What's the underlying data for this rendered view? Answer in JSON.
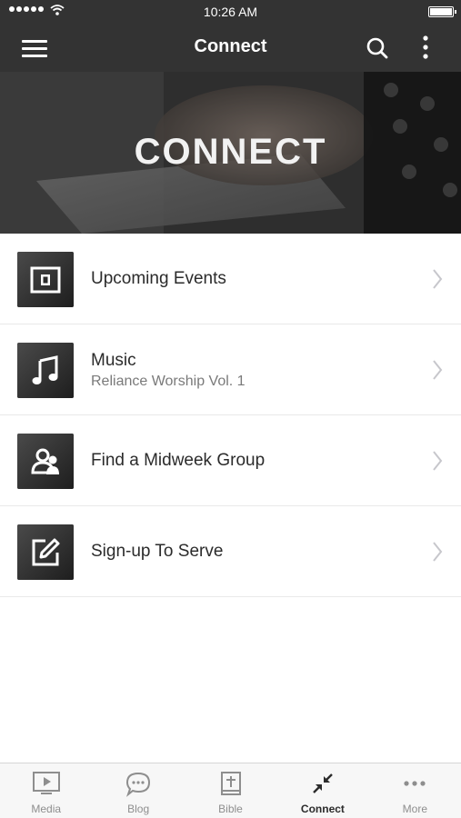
{
  "status_bar": {
    "time": "10:26 AM"
  },
  "nav": {
    "title": "Connect"
  },
  "hero": {
    "title": "CONNECT"
  },
  "list": {
    "items": [
      {
        "label": "Upcoming Events",
        "sublabel": "",
        "icon": "calendar-icon"
      },
      {
        "label": "Music",
        "sublabel": "Reliance Worship Vol. 1",
        "icon": "music-note-icon"
      },
      {
        "label": "Find a Midweek Group",
        "sublabel": "",
        "icon": "group-icon"
      },
      {
        "label": "Sign-up To Serve",
        "sublabel": "",
        "icon": "edit-icon"
      }
    ]
  },
  "tab_bar": {
    "tabs": [
      {
        "label": "Media",
        "icon": "media-icon",
        "active": false
      },
      {
        "label": "Blog",
        "icon": "chat-bubble-icon",
        "active": false
      },
      {
        "label": "Bible",
        "icon": "bible-icon",
        "active": false
      },
      {
        "label": "Connect",
        "icon": "connect-arrows-icon",
        "active": true
      },
      {
        "label": "More",
        "icon": "more-dots-icon",
        "active": false
      }
    ]
  },
  "colors": {
    "nav_bg": "#333333",
    "tab_active": "#2b2b2b",
    "tab_inactive": "#8e8e8e"
  }
}
